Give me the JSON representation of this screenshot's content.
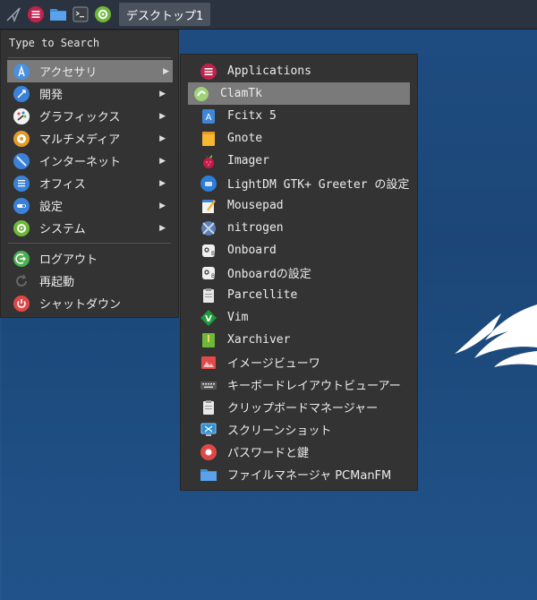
{
  "taskbar": {
    "workspace_label": "デスクトップ1"
  },
  "main_menu": {
    "search_placeholder": "Type to Search",
    "categories": [
      {
        "label": "アクセサリ",
        "icon": "accessories-icon",
        "color": "#3d7fd6"
      },
      {
        "label": "開発",
        "icon": "development-icon",
        "color": "#3d7fd6"
      },
      {
        "label": "グラフィックス",
        "icon": "graphics-icon",
        "color": "#f2f2f2"
      },
      {
        "label": "マルチメディア",
        "icon": "multimedia-icon",
        "color": "#e39b2b"
      },
      {
        "label": "インターネット",
        "icon": "internet-icon",
        "color": "#3d7fd6"
      },
      {
        "label": "オフィス",
        "icon": "office-icon",
        "color": "#3d7fd6"
      },
      {
        "label": "設定",
        "icon": "settings-icon",
        "color": "#3d7fd6"
      },
      {
        "label": "システム",
        "icon": "system-icon",
        "color": "#7bbf3a"
      }
    ],
    "session": [
      {
        "label": "ログアウト",
        "icon": "logout-icon",
        "color": "#4caf50"
      },
      {
        "label": "再起動",
        "icon": "reboot-icon",
        "color": "#777777"
      },
      {
        "label": "シャットダウン",
        "icon": "shutdown-icon",
        "color": "#e04848"
      }
    ]
  },
  "sub_menu": {
    "items": [
      {
        "label": "Applications",
        "mono": true
      },
      {
        "label": "ClamTk",
        "mono": true
      },
      {
        "label": "Fcitx 5",
        "mono": true
      },
      {
        "label": "Gnote",
        "mono": true
      },
      {
        "label": "Imager",
        "mono": true
      },
      {
        "label": "LightDM GTK+ Greeter の設定",
        "mono": true
      },
      {
        "label": "Mousepad",
        "mono": true
      },
      {
        "label": "nitrogen",
        "mono": true
      },
      {
        "label": "Onboard",
        "mono": true
      },
      {
        "label": "Onboardの設定",
        "mono": true
      },
      {
        "label": "Parcellite",
        "mono": true
      },
      {
        "label": "Vim",
        "mono": true
      },
      {
        "label": "Xarchiver",
        "mono": true
      },
      {
        "label": "イメージビューワ",
        "mono": false
      },
      {
        "label": "キーボードレイアウトビューアー",
        "mono": false
      },
      {
        "label": "クリップボードマネージャー",
        "mono": false
      },
      {
        "label": "スクリーンショット",
        "mono": false
      },
      {
        "label": "パスワードと鍵",
        "mono": false
      },
      {
        "label": "ファイルマネージャ PCManFM",
        "mono": false
      }
    ]
  },
  "colors": {
    "menu_bg": "#333333",
    "highlight": "#7a7a7a",
    "desktop": "#1c4a7e",
    "taskbar": "#2c3340"
  }
}
